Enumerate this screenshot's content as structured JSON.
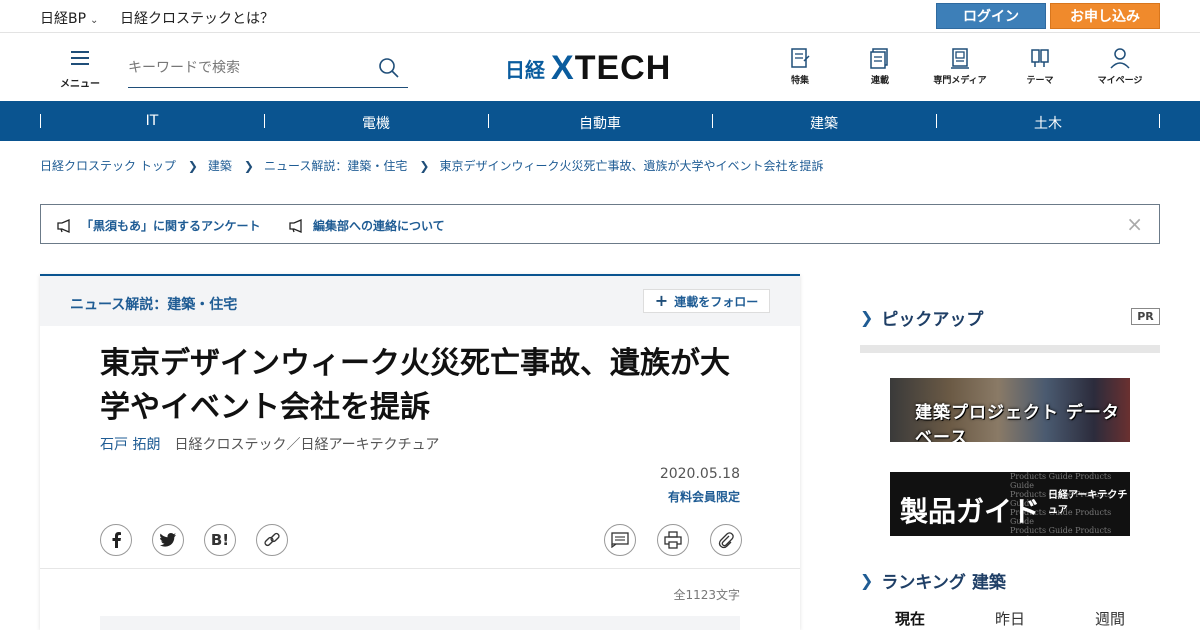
{
  "topbar": {
    "brand": "日経BP",
    "about": "日経クロステックとは？",
    "login": "ログイン",
    "signup": "お申し込み"
  },
  "header": {
    "menu_label": "メニュー",
    "search_placeholder": "キーワードで検索",
    "logo_ja": "日経",
    "logo_x": "X",
    "logo_en": "TECH",
    "nav": [
      {
        "label": "特集",
        "icon": "feature-icon"
      },
      {
        "label": "連載",
        "icon": "series-icon"
      },
      {
        "label": "専門メディア",
        "icon": "media-icon"
      },
      {
        "label": "テーマ",
        "icon": "theme-icon"
      },
      {
        "label": "マイページ",
        "icon": "user-icon"
      }
    ]
  },
  "categories": [
    "IT",
    "電機",
    "自動車",
    "建築",
    "土木"
  ],
  "breadcrumb": [
    "日経クロステック トップ",
    "建築",
    "ニュース解説：建築・住宅",
    "東京デザインウィーク火災死亡事故、遺族が大学やイベント会社を提訴"
  ],
  "notices": [
    "「黒須もあ」に関するアンケート",
    "編集部への連絡について"
  ],
  "article": {
    "series": "ニュース解説：建築・住宅",
    "follow": "連載をフォロー",
    "title": "東京デザインウィーク火災死亡事故、遺族が大学やイベント会社を提訴",
    "author": "石戸 拓朗",
    "publication": "日経クロステック／日経アーキテクチュア",
    "date": "2020.05.18",
    "paid": "有料会員限定",
    "share": [
      "f",
      "t",
      "B!",
      "link"
    ],
    "char_count": "全1123文字"
  },
  "sidebar": {
    "pickup_title": "ピックアップ",
    "pr": "PR",
    "banner1": "建築プロジェクト データベース",
    "banner2": "製品ガイド",
    "banner2_brand": "日経アーキテクチュア",
    "banner2_bg": "Products Guide",
    "ranking_title": "ランキング 建築",
    "ranking_tabs": [
      "現在",
      "昨日",
      "週間"
    ]
  },
  "colors": {
    "brand_blue": "#0a5490",
    "login": "#3d7fb8",
    "signup": "#f08a2c"
  }
}
